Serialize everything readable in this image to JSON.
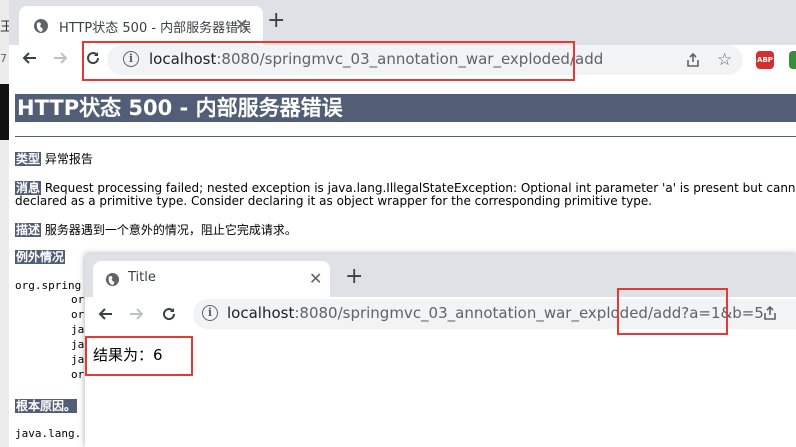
{
  "desktop": {
    "left_char": "王",
    "left_num": "7"
  },
  "back_window": {
    "tab_title": "HTTP状态 500 - 内部服务器错误",
    "close_glyph": "✕",
    "new_tab_glyph": "+",
    "url_host": "localhost",
    "url_path": ":8080/springmvc_03_annotation_war_exploded/add",
    "extension_abp": "ABP"
  },
  "error_page": {
    "title": "HTTP状态 500 - 内部服务器错误",
    "type_label": "类型",
    "type_value": "异常报告",
    "message_label": "消息",
    "message_value": "Request processing failed; nested exception is java.lang.IllegalStateException: Optional int parameter 'a' is present but cannot be translated in",
    "message_value_2": "declared as a primitive type. Consider declaring it as object wrapper for the corresponding primitive type.",
    "description_label": "描述",
    "description_value": "服务器遇到一个意外的情况，阻止它完成请求。",
    "exception_label": "例外情况",
    "stack": [
      "org.spring",
      "or",
      "or",
      "ja",
      "ja",
      "ja",
      "or"
    ],
    "root_cause_label": "根本原因。",
    "root_trace": "java.lang."
  },
  "front_window": {
    "tab_title": "Title",
    "close_glyph": "✕",
    "new_tab_glyph": "+",
    "url_host": "localhost",
    "url_path": ":8080/springmvc_03_annotation_war_exploded/add?a=1&b=5",
    "result_text": "结果为：6"
  },
  "colors": {
    "tomcat_header": "#525d76",
    "highlight_red": "#e53935"
  }
}
